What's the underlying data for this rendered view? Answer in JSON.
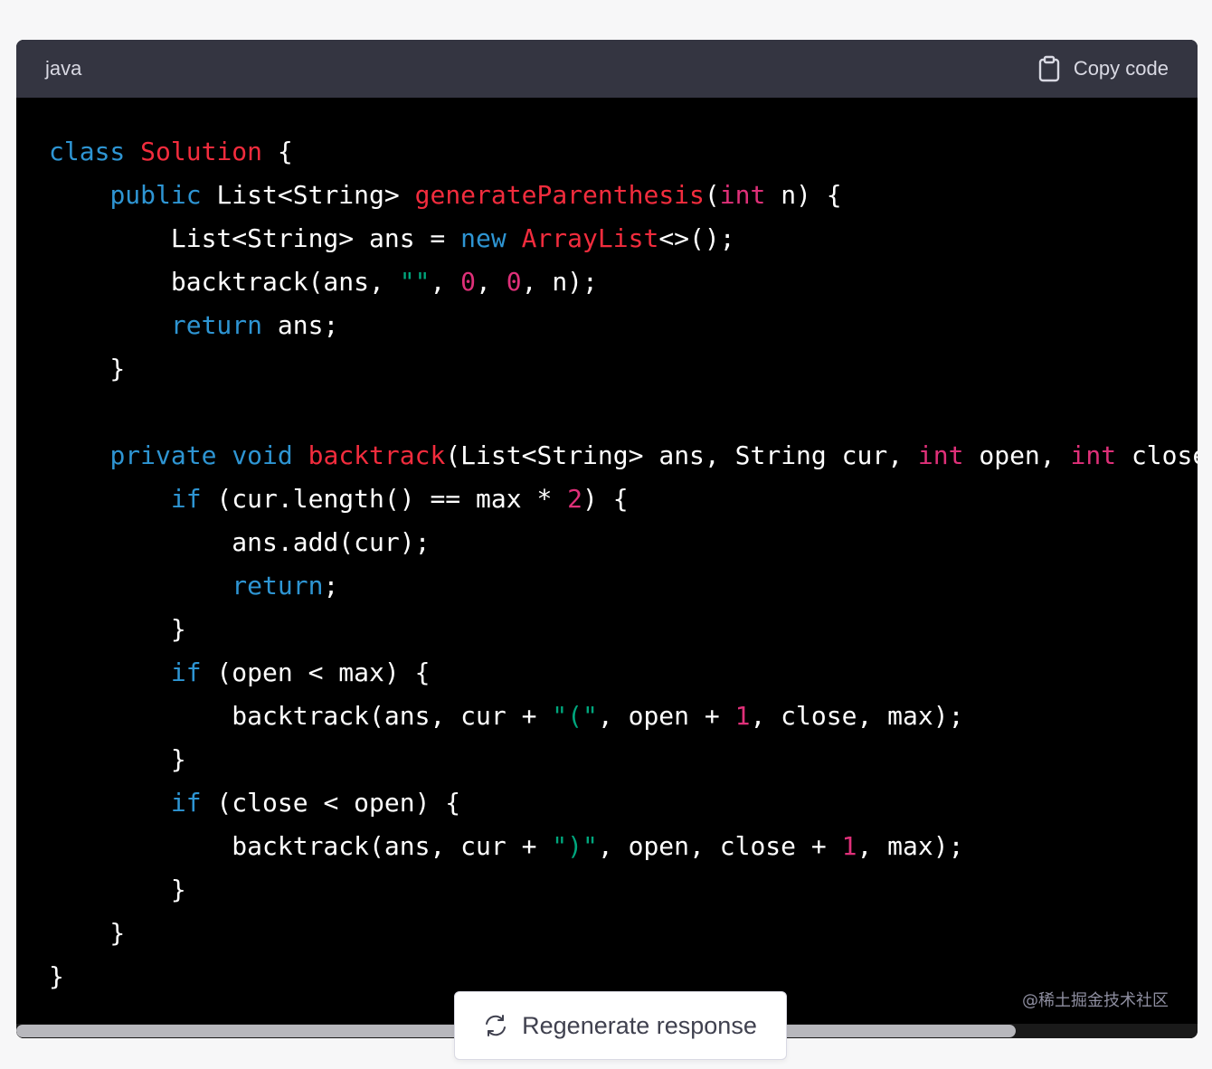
{
  "header": {
    "language": "java",
    "copy_label": "Copy code"
  },
  "code_lines": [
    [
      [
        "kw",
        "class"
      ],
      [
        "plain",
        " "
      ],
      [
        "fn",
        "Solution"
      ],
      [
        "plain",
        " {"
      ]
    ],
    [
      [
        "plain",
        "    "
      ],
      [
        "kw",
        "public"
      ],
      [
        "plain",
        " List<String> "
      ],
      [
        "fn",
        "generateParenthesis"
      ],
      [
        "plain",
        "("
      ],
      [
        "ty",
        "int"
      ],
      [
        "plain",
        " n) {"
      ]
    ],
    [
      [
        "plain",
        "        List<String> ans = "
      ],
      [
        "kw",
        "new"
      ],
      [
        "plain",
        " "
      ],
      [
        "fn",
        "ArrayList"
      ],
      [
        "plain",
        "<>();"
      ]
    ],
    [
      [
        "plain",
        "        backtrack(ans, "
      ],
      [
        "str",
        "\"\""
      ],
      [
        "plain",
        ", "
      ],
      [
        "num",
        "0"
      ],
      [
        "plain",
        ", "
      ],
      [
        "num",
        "0"
      ],
      [
        "plain",
        ", n);"
      ]
    ],
    [
      [
        "plain",
        "        "
      ],
      [
        "kw",
        "return"
      ],
      [
        "plain",
        " ans;"
      ]
    ],
    [
      [
        "plain",
        "    }"
      ]
    ],
    [
      [
        "plain",
        ""
      ]
    ],
    [
      [
        "plain",
        "    "
      ],
      [
        "kw",
        "private"
      ],
      [
        "plain",
        " "
      ],
      [
        "kw",
        "void"
      ],
      [
        "plain",
        " "
      ],
      [
        "fn",
        "backtrack"
      ],
      [
        "plain",
        "(List<String> ans, String cur, "
      ],
      [
        "ty",
        "int"
      ],
      [
        "plain",
        " open, "
      ],
      [
        "ty",
        "int"
      ],
      [
        "plain",
        " close"
      ]
    ],
    [
      [
        "plain",
        "        "
      ],
      [
        "kw",
        "if"
      ],
      [
        "plain",
        " (cur.length() == max * "
      ],
      [
        "num",
        "2"
      ],
      [
        "plain",
        ") {"
      ]
    ],
    [
      [
        "plain",
        "            ans.add(cur);"
      ]
    ],
    [
      [
        "plain",
        "            "
      ],
      [
        "kw",
        "return"
      ],
      [
        "plain",
        ";"
      ]
    ],
    [
      [
        "plain",
        "        }"
      ]
    ],
    [
      [
        "plain",
        "        "
      ],
      [
        "kw",
        "if"
      ],
      [
        "plain",
        " (open < max) {"
      ]
    ],
    [
      [
        "plain",
        "            backtrack(ans, cur + "
      ],
      [
        "str",
        "\"(\""
      ],
      [
        "plain",
        ", open + "
      ],
      [
        "num",
        "1"
      ],
      [
        "plain",
        ", close, max);"
      ]
    ],
    [
      [
        "plain",
        "        }"
      ]
    ],
    [
      [
        "plain",
        "        "
      ],
      [
        "kw",
        "if"
      ],
      [
        "plain",
        " (close < open) {"
      ]
    ],
    [
      [
        "plain",
        "            backtrack(ans, cur + "
      ],
      [
        "str",
        "\")\""
      ],
      [
        "plain",
        ", open, close + "
      ],
      [
        "num",
        "1"
      ],
      [
        "plain",
        ", max);"
      ]
    ],
    [
      [
        "plain",
        "        }"
      ]
    ],
    [
      [
        "plain",
        "    }"
      ]
    ],
    [
      [
        "plain",
        "}"
      ]
    ]
  ],
  "scrollbar": {
    "horizontal_position": 0.0
  },
  "regenerate": {
    "label": "Regenerate response"
  },
  "watermark": "@稀土掘金技术社区",
  "colors": {
    "keyword": "#2e95d3",
    "type": "#df3079",
    "function": "#f22c3d",
    "string": "#00a67d",
    "number": "#df3079",
    "background": "#000000",
    "header": "#343541"
  }
}
